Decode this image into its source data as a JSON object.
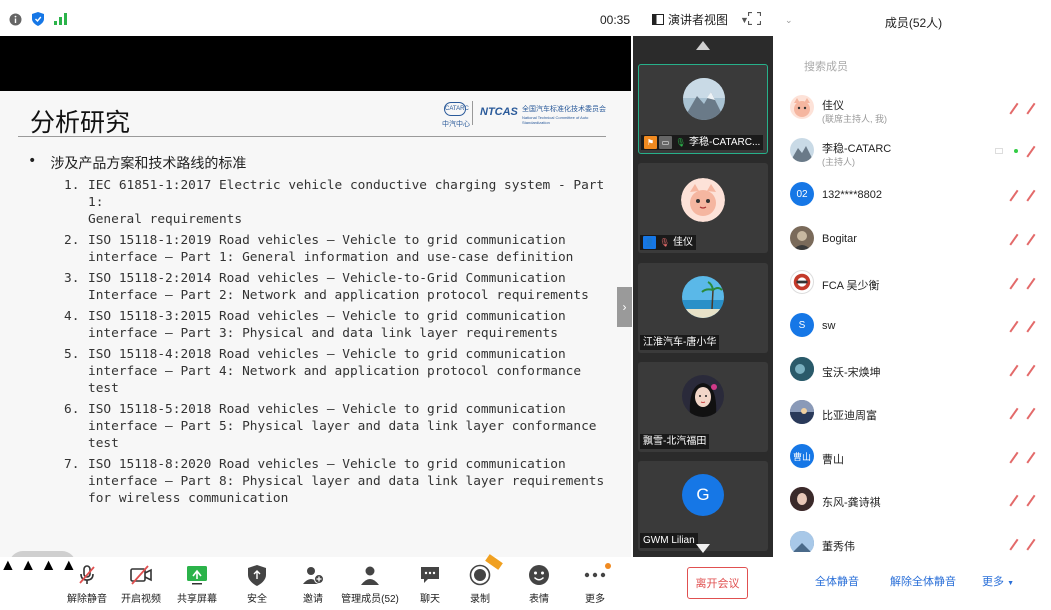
{
  "topbar": {
    "time": "00:35",
    "view_label": "演讲者视图"
  },
  "slide": {
    "title": "分析研究",
    "logo_caac_text": "中汽中心",
    "logo_ntcas": "NTCAS",
    "logo_ntcas_cn": "全国汽车标准化技术委员会",
    "logo_ntcas_en": "National Technical Committee of Auto Standardization",
    "bullet": "涉及产品方案和技术路线的标准",
    "items": [
      {
        "num": "1.",
        "text": "IEC 61851-1:2017 Electric vehicle conductive charging system - Part 1:\nGeneral requirements"
      },
      {
        "num": "2.",
        "text": "ISO 15118-1:2019 Road vehicles — Vehicle to grid communication\ninterface — Part 1: General information and use-case definition"
      },
      {
        "num": "3.",
        "text": "ISO 15118-2:2014 Road vehicles — Vehicle-to-Grid Communication\nInterface — Part 2: Network and application protocol requirements"
      },
      {
        "num": "4.",
        "text": "ISO 15118-3:2015 Road vehicles — Vehicle to grid communication\ninterface — Part 3: Physical and data link layer requirements"
      },
      {
        "num": "5.",
        "text": "ISO 15118-4:2018 Road vehicles — Vehicle to grid communication\ninterface — Part 4: Network and application protocol conformance test"
      },
      {
        "num": "6.",
        "text": "ISO 15118-5:2018 Road vehicles — Vehicle to grid communication\ninterface — Part 5: Physical layer and data link layer conformance\ntest"
      },
      {
        "num": "7.",
        "text": "ISO 15118-8:2020 Road vehicles — Vehicle to grid communication\ninterface — Part 8: Physical layer and data link layer requirements\nfor wireless communication"
      }
    ]
  },
  "video_tiles": [
    {
      "name": "李稳-CATARC...",
      "avatar": "mountain-avatar",
      "active": true
    },
    {
      "name": "佳仪",
      "avatar": "cartoon-avatar",
      "active": false
    },
    {
      "name": "江淮汽车-唐小华",
      "avatar": "beach-avatar",
      "active": false
    },
    {
      "name": "飘雪-北汽福田",
      "avatar": "girl-avatar",
      "active": false
    },
    {
      "name": "GWM Lilian",
      "avatar": "letter-avatar",
      "initial": "G",
      "active": false
    }
  ],
  "sidebar": {
    "title": "成员(52人)",
    "search_placeholder": "搜索成员",
    "members": [
      {
        "name": "佳仪",
        "role": "(联席主持人, 我)",
        "avatar": "cartoon",
        "color": "#f7c7b6"
      },
      {
        "name": "李稳-CATARC",
        "role": "(主持人)",
        "avatar": "mountain",
        "color": "#9fb8c8"
      },
      {
        "name": "132****8802",
        "role": "",
        "avatar": "text",
        "initial": "02",
        "color": "#1677e6"
      },
      {
        "name": "Bogitar",
        "role": "",
        "avatar": "photo",
        "color": "#7a6a5a"
      },
      {
        "name": "FCA 吴少衡",
        "role": "",
        "avatar": "logo",
        "color": "#c43a2a"
      },
      {
        "name": "sw",
        "role": "",
        "avatar": "text",
        "initial": "S",
        "color": "#1677e6"
      },
      {
        "name": "宝沃-宋焕坤",
        "role": "",
        "avatar": "photo",
        "color": "#3a6a7a"
      },
      {
        "name": "比亚迪周富",
        "role": "",
        "avatar": "photo",
        "color": "#4a5a7a"
      },
      {
        "name": "曹山",
        "role": "",
        "avatar": "text",
        "initial": "曹山",
        "color": "#1677e6"
      },
      {
        "name": "东风-龚诗祺",
        "role": "",
        "avatar": "photo",
        "color": "#8a4a5a"
      },
      {
        "name": "董秀伟",
        "role": "",
        "avatar": "photo",
        "color": "#6a8aaa"
      }
    ],
    "actions": {
      "mute_all": "全体静音",
      "unmute_all": "解除全体静音",
      "more": "更多"
    }
  },
  "toolbar": {
    "unmute": "解除静音",
    "start_video": "开启视频",
    "share_screen": "共享屏幕",
    "security": "安全",
    "invite": "邀请",
    "manage_members": "管理成员(52)",
    "chat": "聊天",
    "record": "录制",
    "reactions": "表情",
    "more": "更多",
    "leave": "离开会议"
  },
  "colors": {
    "accent_blue": "#1677e6",
    "leave_red": "#e05050",
    "active_green": "#27b08a",
    "mute_red": "#e36a6a"
  }
}
